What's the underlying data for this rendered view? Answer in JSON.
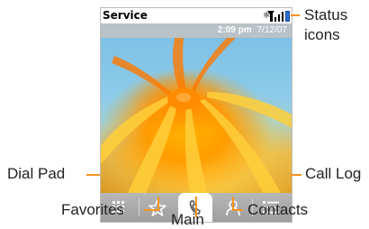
{
  "status_bar": {
    "carrier": "Service",
    "icons": [
      "bluetooth-icon",
      "signal-icon",
      "battery-icon"
    ]
  },
  "date_bar": {
    "time": "2:09 pm",
    "date": "7/12/07"
  },
  "dock": {
    "buttons": [
      "dial-pad-icon",
      "star-icon",
      "phone-icon",
      "person-icon",
      "list-icon"
    ],
    "active": "phone-icon"
  },
  "callouts": {
    "status_line1": "Status",
    "status_line2": "icons",
    "dial_pad": "Dial Pad",
    "favorites": "Favorites",
    "main": "Main",
    "contacts": "Contacts",
    "call_log": "Call Log"
  },
  "colors": {
    "callout_line": "#f7941d",
    "date_bar": "#b9c2c6",
    "dock": "#a9a9a9"
  }
}
